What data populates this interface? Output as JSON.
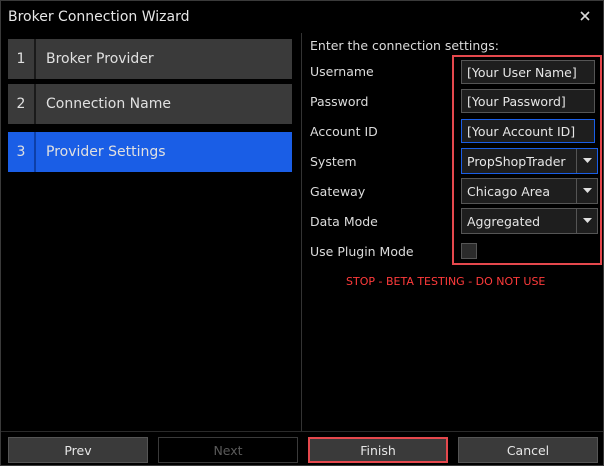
{
  "window": {
    "title": "Broker Connection Wizard"
  },
  "steps": [
    {
      "num": "1",
      "label": "Broker Provider"
    },
    {
      "num": "2",
      "label": "Connection Name"
    },
    {
      "num": "3",
      "label": "Provider Settings"
    }
  ],
  "settings": {
    "heading": "Enter the connection settings:",
    "username": {
      "label": "Username",
      "value": "[Your User Name]"
    },
    "password": {
      "label": "Password",
      "value": "[Your Password]"
    },
    "account_id": {
      "label": "Account ID",
      "value": "[Your Account ID]"
    },
    "system": {
      "label": "System",
      "value": "PropShopTrader"
    },
    "gateway": {
      "label": "Gateway",
      "value": "Chicago Area"
    },
    "data_mode": {
      "label": "Data Mode",
      "value": "Aggregated"
    },
    "plugin_mode": {
      "label": "Use Plugin Mode"
    },
    "warning": "STOP - BETA TESTING - DO NOT USE"
  },
  "buttons": {
    "prev": "Prev",
    "next": "Next",
    "finish": "Finish",
    "cancel": "Cancel"
  },
  "colors": {
    "active_step": "#1a5ee6",
    "highlight": "#e5484d",
    "warning": "#ff3b3b"
  }
}
